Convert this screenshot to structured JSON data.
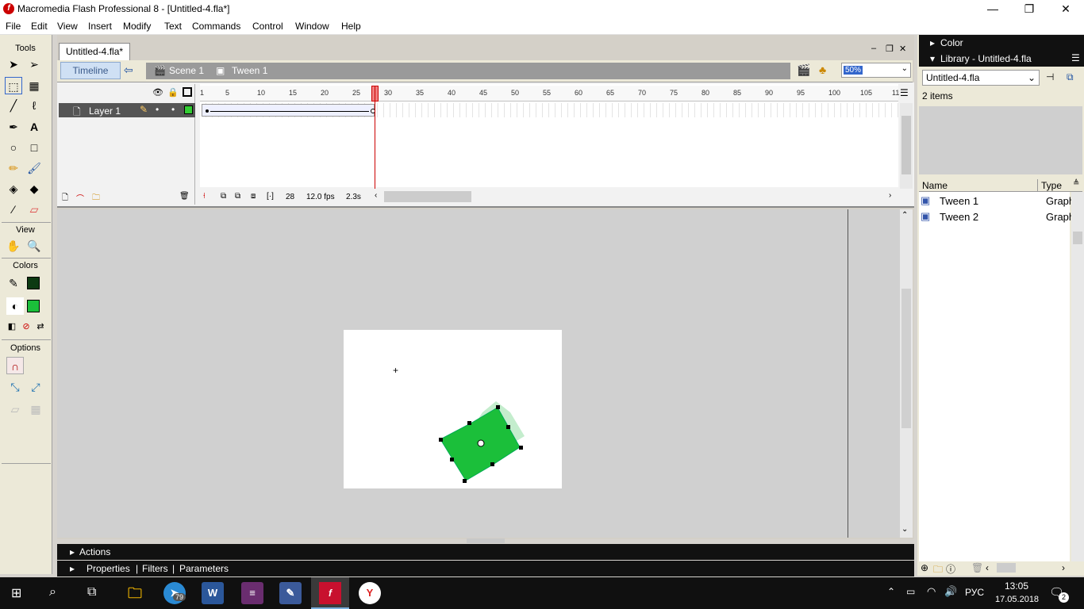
{
  "window": {
    "title": "Macromedia Flash Professional 8 - [Untitled-4.fla*]",
    "app_icon": "f"
  },
  "menu": [
    "File",
    "Edit",
    "View",
    "Insert",
    "Modify",
    "Text",
    "Commands",
    "Control",
    "Window",
    "Help"
  ],
  "tools": {
    "header": "Tools",
    "view_header": "View",
    "colors_header": "Colors",
    "options_header": "Options",
    "stroke_color": "#0c3a12",
    "fill_color": "#1bbf3a"
  },
  "document": {
    "tab": "Untitled-4.fla*",
    "timeline_button": "Timeline",
    "scene": "Scene 1",
    "symbol": "Tween 1",
    "zoom": "50%"
  },
  "timeline": {
    "layer": "Layer 1",
    "ruler": [
      "1",
      "5",
      "10",
      "15",
      "20",
      "25",
      "30",
      "35",
      "40",
      "45",
      "50",
      "55",
      "60",
      "65",
      "70",
      "75",
      "80",
      "85",
      "90",
      "95",
      "100",
      "105",
      "11"
    ],
    "current_frame": "28",
    "fps": "12.0 fps",
    "time": "2.3s"
  },
  "panels": {
    "actions": "Actions",
    "properties": "Properties",
    "filters": "Filters",
    "parameters": "Parameters"
  },
  "right": {
    "color": "Color",
    "library_title": "Library - Untitled-4.fla",
    "library_doc": "Untitled-4.fla",
    "count": "2 items",
    "col_name": "Name",
    "col_type": "Type",
    "items": [
      {
        "name": "Tween 1",
        "type": "Graph"
      },
      {
        "name": "Tween 2",
        "type": "Graph"
      }
    ]
  },
  "taskbar": {
    "lang": "РУС",
    "time": "13:05",
    "date": "17.05.2018",
    "telegram_badge": "79",
    "notif": "2"
  }
}
